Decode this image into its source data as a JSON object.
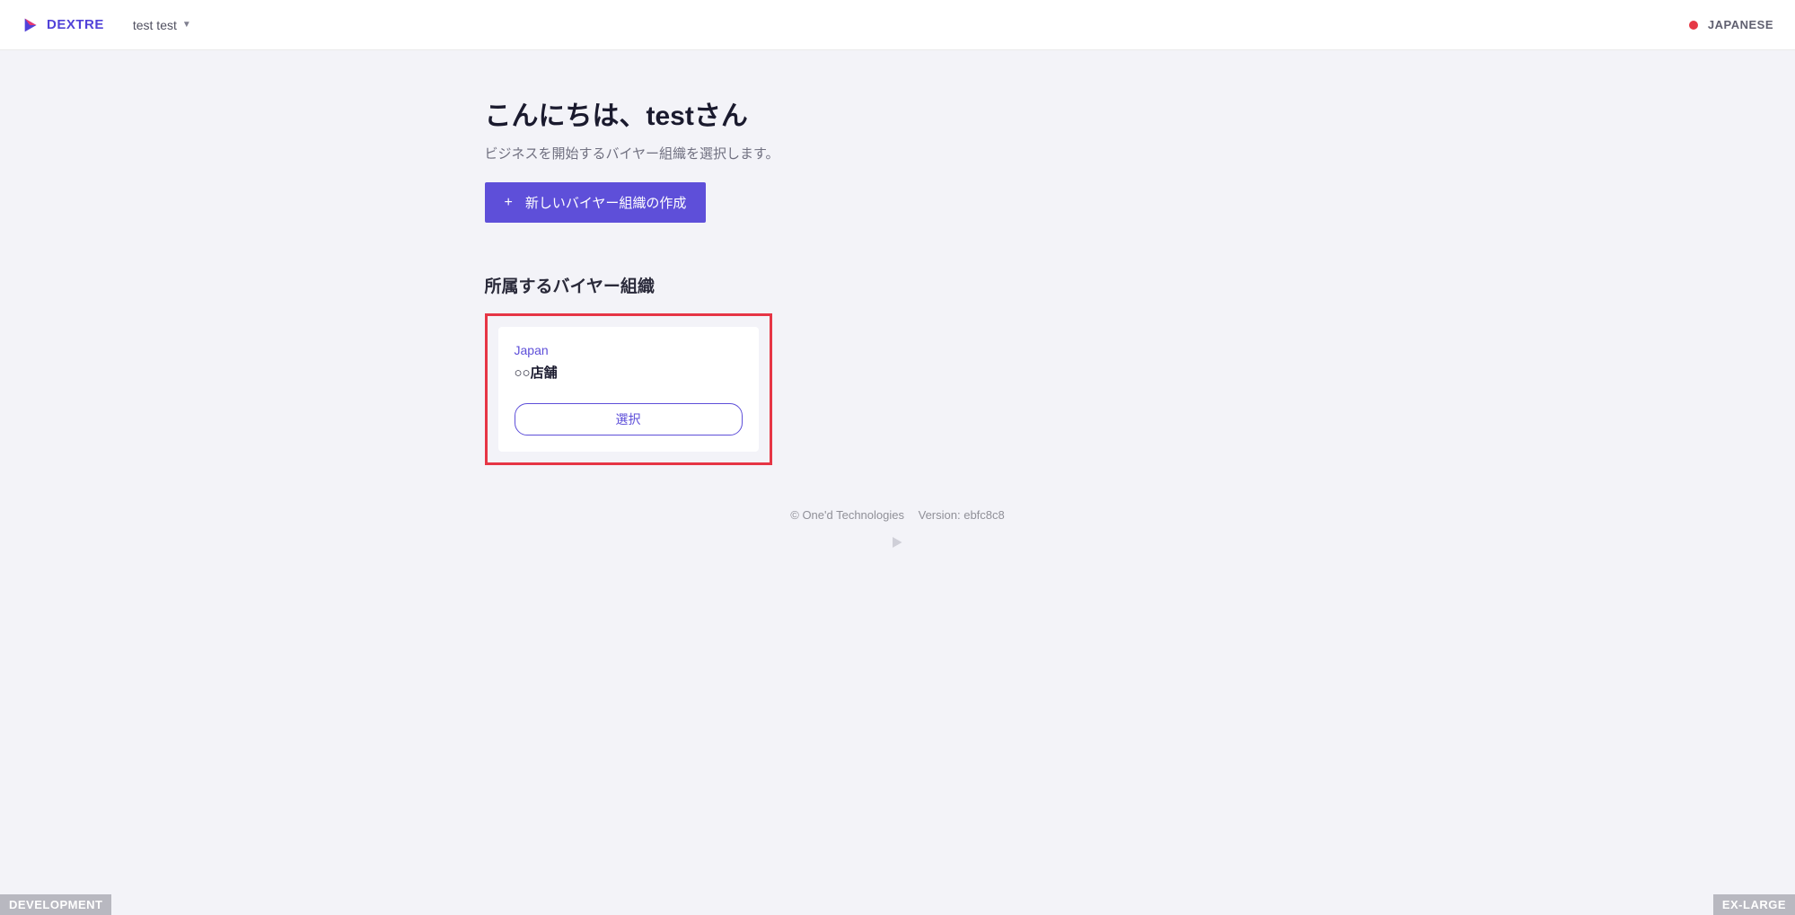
{
  "header": {
    "logo_text": "DEXTRE",
    "user_name": "test test",
    "language": "JAPANESE"
  },
  "main": {
    "greeting_title": "こんにちは、testさん",
    "greeting_subtitle": "ビジネスを開始するバイヤー組織を選択します。",
    "create_button_label": "新しいバイヤー組織の作成",
    "section_title": "所属するバイヤー組織",
    "organization": {
      "country": "Japan",
      "name": "○○店舗",
      "select_label": "選択"
    }
  },
  "footer": {
    "copyright": "© One'd Technologies",
    "version": "Version: ebfc8c8"
  },
  "badges": {
    "env": "DEVELOPMENT",
    "size": "EX-LARGE"
  }
}
